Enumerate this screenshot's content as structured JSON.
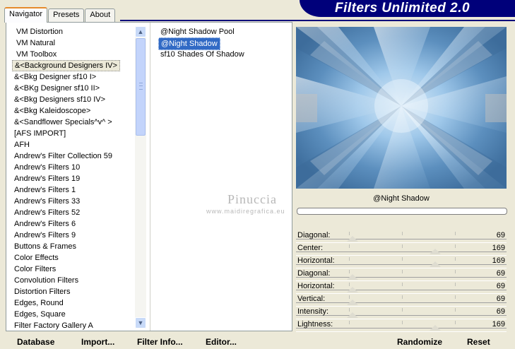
{
  "tabs": [
    {
      "label": "Navigator",
      "active": true
    },
    {
      "label": "Presets",
      "active": false
    },
    {
      "label": "About",
      "active": false
    }
  ],
  "banner_title": "Filters Unlimited 2.0",
  "categories": [
    "VM Distortion",
    "VM Natural",
    "VM Toolbox",
    "&<Background Designers IV>",
    "&<Bkg Designer sf10 I>",
    "&<BKg Designer sf10 II>",
    "&<Bkg Designers sf10 IV>",
    "&<Bkg Kaleidoscope>",
    "&<Sandflower Specials^v^ >",
    "[AFS IMPORT]",
    "AFH",
    "Andrew's Filter Collection 59",
    "Andrew's Filters 10",
    "Andrew's Filters 19",
    "Andrew's Filters 1",
    "Andrew's Filters 33",
    "Andrew's Filters 52",
    "Andrew's Filters 6",
    "Andrew's Filters 9",
    "Buttons & Frames",
    "Color Effects",
    "Color Filters",
    "Convolution Filters",
    "Distortion Filters",
    "Edges, Round",
    "Edges, Square",
    "Filter Factory Gallery A"
  ],
  "filters": [
    "@Night Shadow Pool",
    "@Night Shadow",
    "sf10 Shades Of Shadow"
  ],
  "selected_filter_name": "@Night Shadow",
  "params": [
    {
      "label": "Diagonal:",
      "value": "69",
      "level": 0.27
    },
    {
      "label": "Center:",
      "value": "169",
      "level": 0.66
    },
    {
      "label": "Horizontal:",
      "value": "169",
      "level": 0.66
    },
    {
      "label": "Diagonal:",
      "value": "69",
      "level": 0.27
    },
    {
      "label": "Horizontal:",
      "value": "69",
      "level": 0.27
    },
    {
      "label": "Vertical:",
      "value": "69",
      "level": 0.27
    },
    {
      "label": "Intensity:",
      "value": "69",
      "level": 0.27
    },
    {
      "label": "Lightness:",
      "value": "169",
      "level": 0.66
    }
  ],
  "bottom_buttons": {
    "database": "Database",
    "import": "Import...",
    "filter_info": "Filter Info...",
    "editor": "Editor..."
  },
  "right_buttons": {
    "randomize": "Randomize",
    "reset": "Reset"
  },
  "watermark": {
    "line1": "Pinuccia",
    "line2": "www.maidiregrafica.eu"
  },
  "colors": {
    "banner": "#00007a",
    "selection": "#316ac5",
    "active_tab_accent": "#e68b2c"
  },
  "icons": {
    "scroll_up": "▲",
    "scroll_down": "▼"
  }
}
